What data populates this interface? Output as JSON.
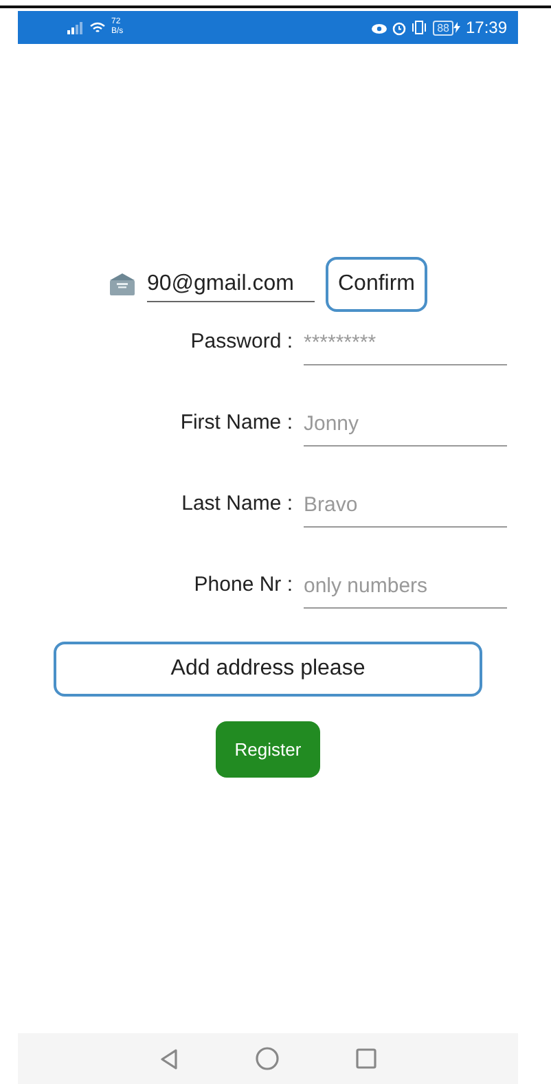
{
  "status_bar": {
    "net_speed": "72",
    "net_unit": "B/s",
    "battery": "88",
    "time": "17:39"
  },
  "email": {
    "value": "90@gmail.com",
    "confirm": "Confirm"
  },
  "fields": [
    {
      "label": "Password :",
      "placeholder": "*********"
    },
    {
      "label": "First Name :",
      "placeholder": "Jonny"
    },
    {
      "label": "Last Name :",
      "placeholder": "Bravo"
    },
    {
      "label": "Phone Nr :",
      "placeholder": "only numbers"
    }
  ],
  "address_button": "Add address please",
  "register_button": "Register"
}
